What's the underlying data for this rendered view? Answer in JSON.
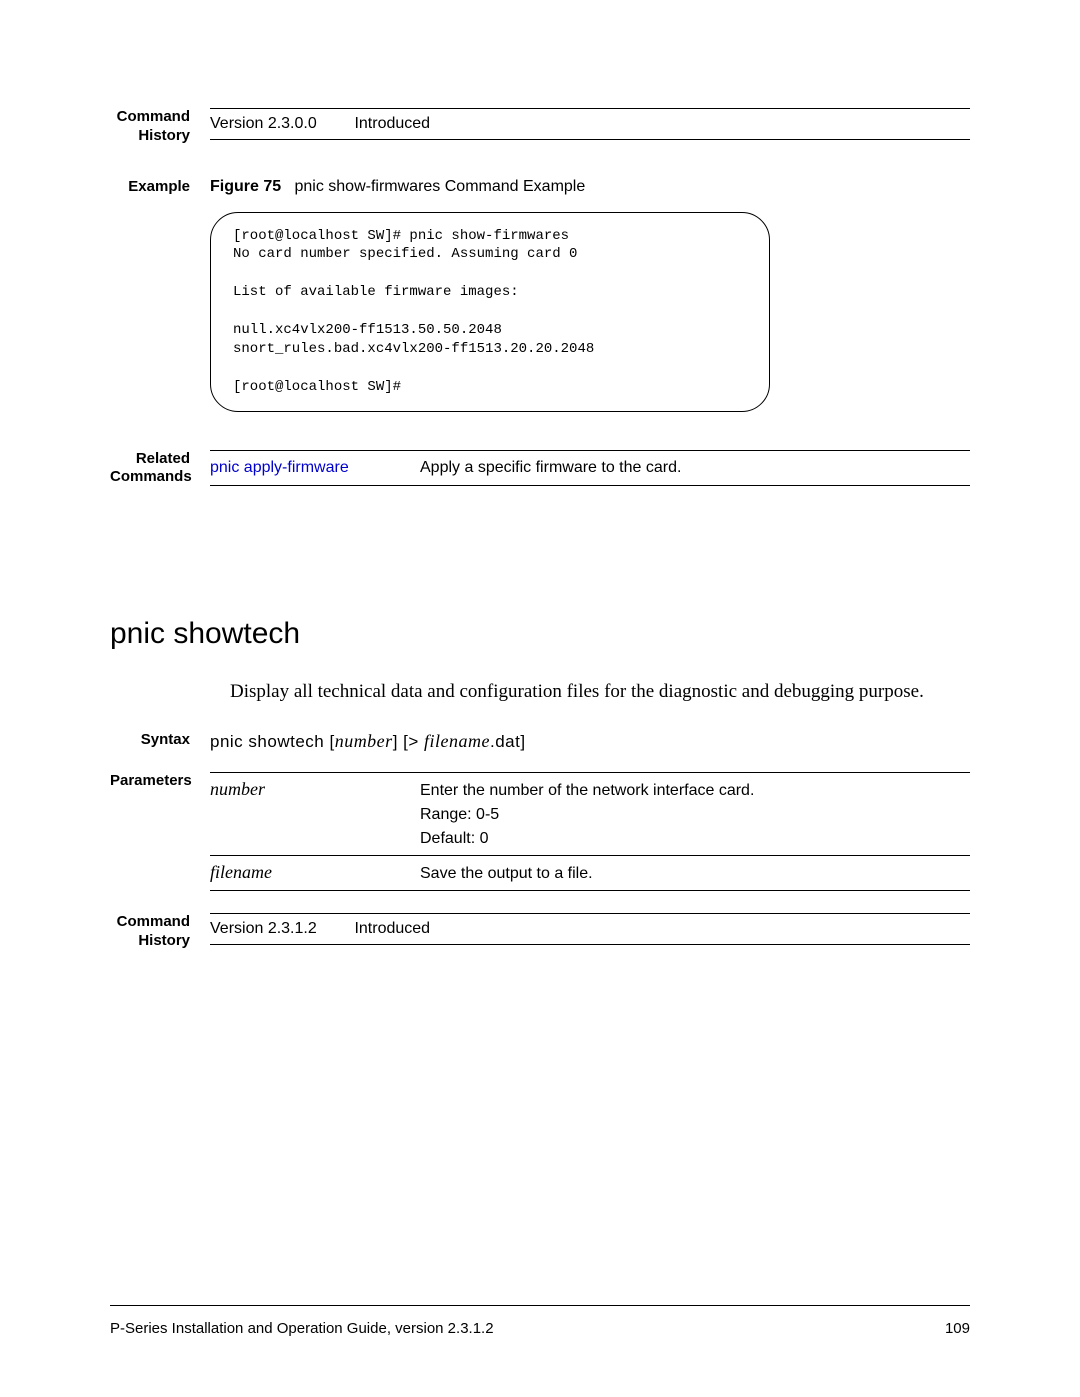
{
  "hist1": {
    "label": "Command History",
    "version": "Version 2.3.0.0",
    "status": "Introduced"
  },
  "example": {
    "label": "Example",
    "fig_label": "Figure 75",
    "fig_title": "pnic show-firmwares Command Example",
    "terminal": "[root@localhost SW]# pnic show-firmwares\nNo card number specified. Assuming card 0\n\nList of available firmware images:\n\nnull.xc4vlx200-ff1513.50.50.2048\nsnort_rules.bad.xc4vlx200-ff1513.20.20.2048\n\n[root@localhost SW]#"
  },
  "related": {
    "label": "Related Commands",
    "link": "pnic apply-firmware",
    "desc": "Apply a specific firmware to the card."
  },
  "section": {
    "title": "pnic showtech",
    "desc": "Display all technical data and configuration files for the diagnostic and debugging purpose."
  },
  "syntax": {
    "label": "Syntax",
    "cmd": "pnic showtech",
    "arg1": "number",
    "mid": "] [> ",
    "arg2": "filename",
    "suffix": ".dat]"
  },
  "params": {
    "label": "Parameters",
    "rows": [
      {
        "name": "number",
        "desc1": "Enter the number of the network interface card.",
        "desc2": "Range: 0-5",
        "desc3": "Default: 0"
      },
      {
        "name": "filename",
        "desc1": "Save the output to a file."
      }
    ]
  },
  "hist2": {
    "label": "Command History",
    "version": "Version 2.3.1.2",
    "status": "Introduced"
  },
  "footer": {
    "left": "P-Series Installation and Operation Guide, version 2.3.1.2",
    "right": "109"
  }
}
